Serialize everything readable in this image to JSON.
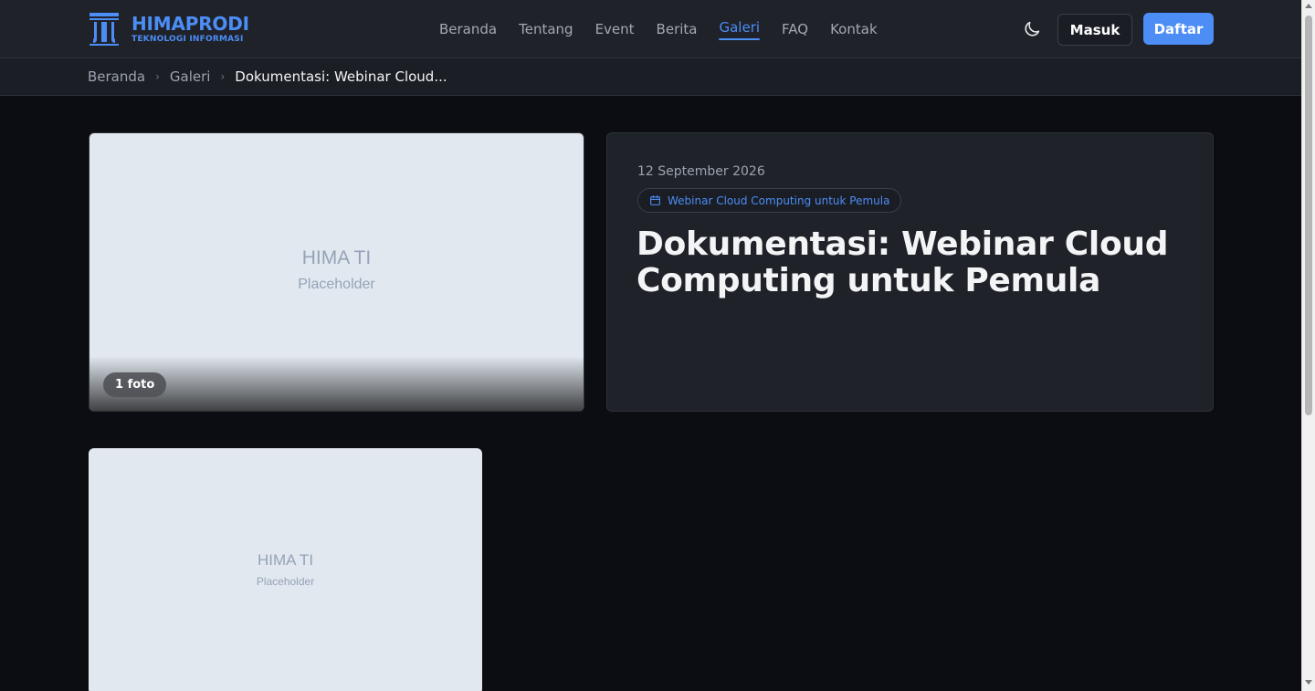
{
  "brand": {
    "title": "HIMAPRODI",
    "subtitle": "TEKNOLOGI INFORMASI",
    "color": "#4c8df6"
  },
  "nav": {
    "items": [
      {
        "label": "Beranda",
        "active": false
      },
      {
        "label": "Tentang",
        "active": false
      },
      {
        "label": "Event",
        "active": false
      },
      {
        "label": "Berita",
        "active": false
      },
      {
        "label": "Galeri",
        "active": true
      },
      {
        "label": "FAQ",
        "active": false
      },
      {
        "label": "Kontak",
        "active": false
      }
    ],
    "theme_icon": "moon-icon"
  },
  "auth": {
    "login_label": "Masuk",
    "register_label": "Daftar"
  },
  "breadcrumb": {
    "home": "Beranda",
    "section": "Galeri",
    "current": "Dokumentasi: Webinar Cloud..."
  },
  "gallery": {
    "main_image": {
      "placeholder_title": "HIMA TI",
      "placeholder_sub": "Placeholder",
      "photo_count_label": "1 foto"
    },
    "info": {
      "date": "12 September 2026",
      "event_icon": "calendar-icon",
      "event_name": "Webinar Cloud Computing untuk Pemula",
      "title": "Dokumentasi: Webinar Cloud Computing untuk Pemula"
    },
    "thumbnails": [
      {
        "placeholder_title": "HIMA TI",
        "placeholder_sub": "Placeholder"
      }
    ]
  },
  "colors": {
    "accent": "#4c8df6",
    "background": "#0b0d12",
    "surface": "#1f2229",
    "placeholder": "#e2e8f0"
  }
}
